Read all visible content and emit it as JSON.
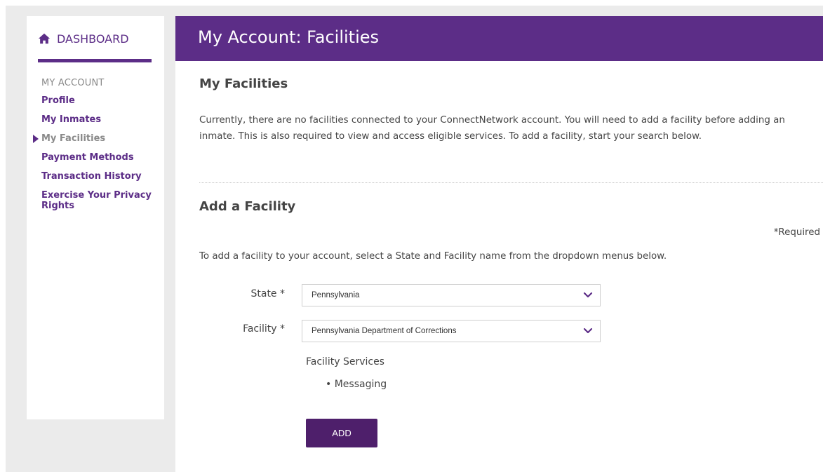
{
  "sidebar": {
    "dashboard_label": "DASHBOARD",
    "section_heading": "MY ACCOUNT",
    "items": [
      {
        "label": "Profile"
      },
      {
        "label": "My Inmates"
      },
      {
        "label": "My Facilities"
      },
      {
        "label": "Payment Methods"
      },
      {
        "label": "Transaction History"
      },
      {
        "label": "Exercise Your Privacy Rights"
      }
    ]
  },
  "header": {
    "title": "My Account: Facilities"
  },
  "my_facilities": {
    "title": "My Facilities",
    "line1": "Currently, there are no facilities connected to your ConnectNetwork account. You will need to add a facility before adding an",
    "line2": "inmate. This is also required to view and access eligible services. To add a facility, start your search below."
  },
  "add_facility": {
    "title": "Add a Facility",
    "required_note": "*Required",
    "instructions": "To add a facility to your account, select a State and Facility name from the dropdown menus below.",
    "state_label": "State *",
    "state_value": "Pennsylvania",
    "facility_label": "Facility *",
    "facility_value": "Pennsylvania Department of Corrections",
    "services_title": "Facility Services",
    "services": [
      "Messaging"
    ],
    "add_button": "ADD"
  },
  "colors": {
    "brand_purple": "#5c2d87",
    "button_purple": "#4e1f6b"
  },
  "icons": {
    "dashboard": "home-icon",
    "active_marker": "triangle-right-icon",
    "dropdown": "chevron-down-icon"
  }
}
